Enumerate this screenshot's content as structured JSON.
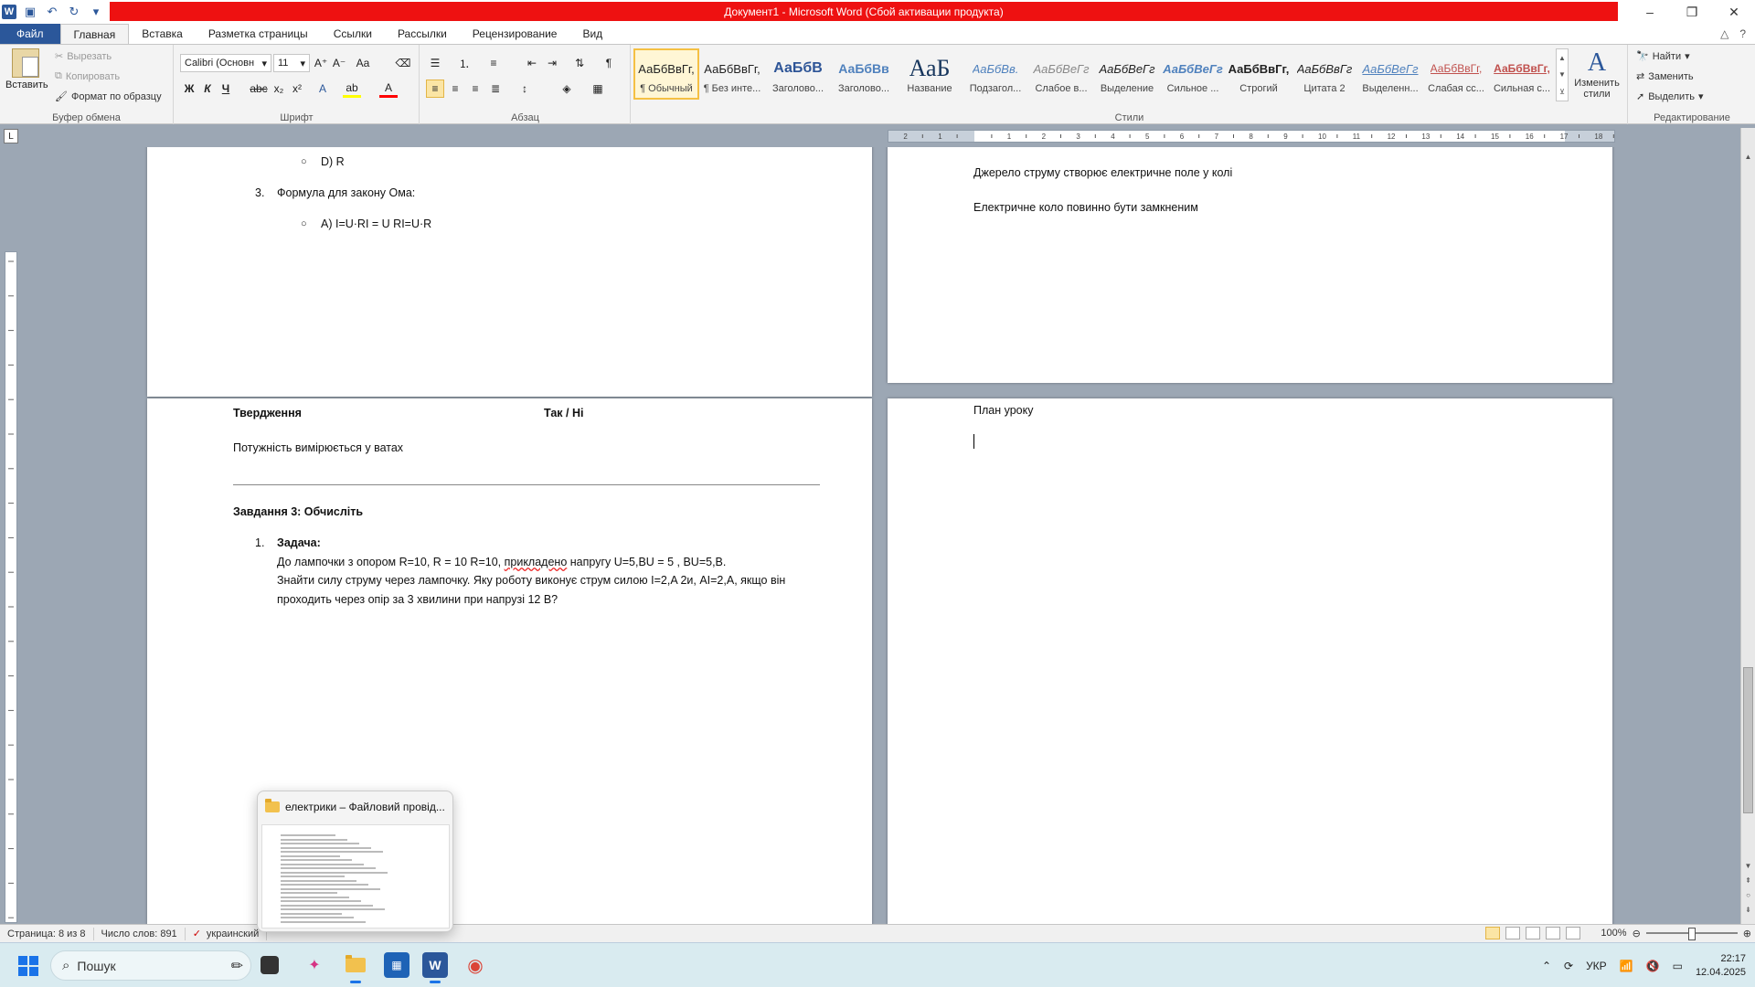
{
  "titlebar": {
    "title": "Документ1  -  Microsoft Word (Сбой активации продукта)",
    "minimize": "–",
    "restore": "❐",
    "close": "✕"
  },
  "tabs": [
    "Файл",
    "Главная",
    "Вставка",
    "Разметка страницы",
    "Ссылки",
    "Рассылки",
    "Рецензирование",
    "Вид"
  ],
  "ribbon": {
    "clipboard": {
      "label": "Буфер обмена",
      "paste": "Вставить",
      "cut": "Вырезать",
      "copy": "Копировать",
      "format_painter": "Формат по образцу"
    },
    "font": {
      "label": "Шрифт",
      "font_name": "Calibri (Основн",
      "font_size": "11"
    },
    "paragraph": {
      "label": "Абзац"
    },
    "styles": {
      "label": "Стили",
      "items": [
        {
          "sample": "АаБбВвГг,",
          "name": "¶ Обычный"
        },
        {
          "sample": "АаБбВвГг,",
          "name": "¶ Без инте..."
        },
        {
          "sample": "АаБбВ",
          "name": "Заголово..."
        },
        {
          "sample": "АаБбВв",
          "name": "Заголово..."
        },
        {
          "sample": "АаБ",
          "name": "Название"
        },
        {
          "sample": "АаБбВв.",
          "name": "Подзагол..."
        },
        {
          "sample": "АаБбВеГг",
          "name": "Слабое в..."
        },
        {
          "sample": "АаБбВеГг",
          "name": "Выделение"
        },
        {
          "sample": "АаБбВеГг",
          "name": "Сильное ..."
        },
        {
          "sample": "АаБбВвГг,",
          "name": "Строгий"
        },
        {
          "sample": "АаБбВвГг",
          "name": "Цитата 2"
        },
        {
          "sample": "АаБбВеГг",
          "name": "Выделенн..."
        },
        {
          "sample": "АаБбВвГг,",
          "name": "Слабая сс..."
        },
        {
          "sample": "АаБбВвГг,",
          "name": "Сильная с..."
        }
      ],
      "change_styles": "Изменить стили"
    },
    "editing": {
      "label": "Редактирование",
      "find": "Найти",
      "replace": "Заменить",
      "select": "Выделить"
    }
  },
  "page_left": {
    "option_d": "D) R",
    "q3_num": "3.",
    "q3_text": "Формула для закону Ома:",
    "q3_option_a": "A) I=U·RI = U  RI=U·R",
    "table_h1": "Твердження",
    "table_h2": "Так / Ні",
    "statement": "Потужність вимірюється у ватах",
    "task3": "Завдання 3: Обчисліть",
    "t1_num": "1.",
    "t1_title": "Задача:",
    "t1_line1_a": "До лампочки з опором R=10, R = 10  R=10,  ",
    "t1_line1_err": "прикладено",
    "t1_line1_b": " напругу U=5,BU = 5 , BU=5,B.",
    "t1_line2": "Знайти силу струму через лампочку. Яку роботу виконує струм силою I=2,A 2и,  AI=2,A, якщо він",
    "t1_line3": "проходить через опір за 3 хвилини при напрузі 12 В?"
  },
  "page_right": {
    "line1": "Джерело струму створює електричне поле у колі",
    "line2": "Електричне коло повинно бути замкненим",
    "line3": "План уроку"
  },
  "statusbar": {
    "page": "Страница: 8 из 8",
    "words": "Число слов: 891",
    "language": "украинский",
    "zoom": "100%"
  },
  "thumbnail": {
    "title": "електрики – Файловий провід..."
  },
  "taskbar": {
    "search_placeholder": "Пошук",
    "lang": "УКР",
    "time": "22:17",
    "date": "12.04.2025"
  }
}
